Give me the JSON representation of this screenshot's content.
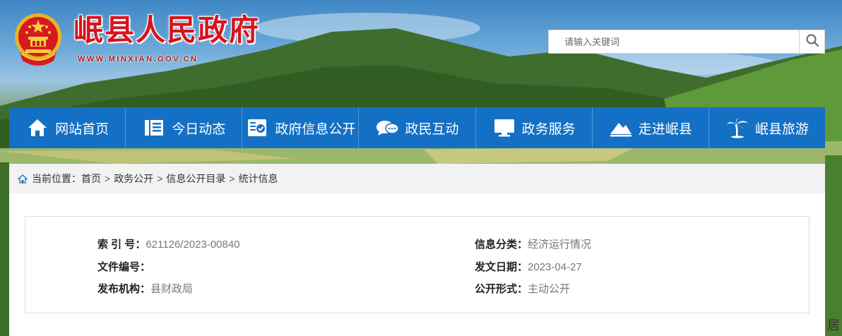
{
  "header": {
    "site_title": "岷县人民政府",
    "site_url": "WWW.MINXIAN.GOV.CN"
  },
  "search": {
    "placeholder": "请输入关键词",
    "icon": "search-icon"
  },
  "nav": {
    "items": [
      {
        "label": "网站首页",
        "icon": "home-icon"
      },
      {
        "label": "今日动态",
        "icon": "news-icon"
      },
      {
        "label": "政府信息公开",
        "icon": "info-board-icon"
      },
      {
        "label": "政民互动",
        "icon": "chat-icon"
      },
      {
        "label": "政务服务",
        "icon": "monitor-icon"
      },
      {
        "label": "走进岷县",
        "icon": "mountain-icon"
      },
      {
        "label": "岷县旅游",
        "icon": "palm-tree-icon"
      }
    ]
  },
  "breadcrumb": {
    "prefix": "当前位置：",
    "items": [
      "首页",
      "政务公开",
      "信息公开目录",
      "统计信息"
    ],
    "separator": ">"
  },
  "meta": {
    "index_label": "索 引 号：",
    "index_value": "621126/2023-00840",
    "doc_no_label": "文件编号：",
    "doc_no_value": "",
    "publisher_label": "发布机构：",
    "publisher_value": "县财政局",
    "category_label": "信息分类：",
    "category_value": "经济运行情况",
    "date_label": "发文日期：",
    "date_value": "2023-04-27",
    "public_label": "公开形式：",
    "public_value": "主动公开"
  },
  "side_fragment": "居",
  "colors": {
    "nav_bg": "#1470c4",
    "title_red": "#d9121b",
    "crumb_bg": "#f2f2f2"
  }
}
